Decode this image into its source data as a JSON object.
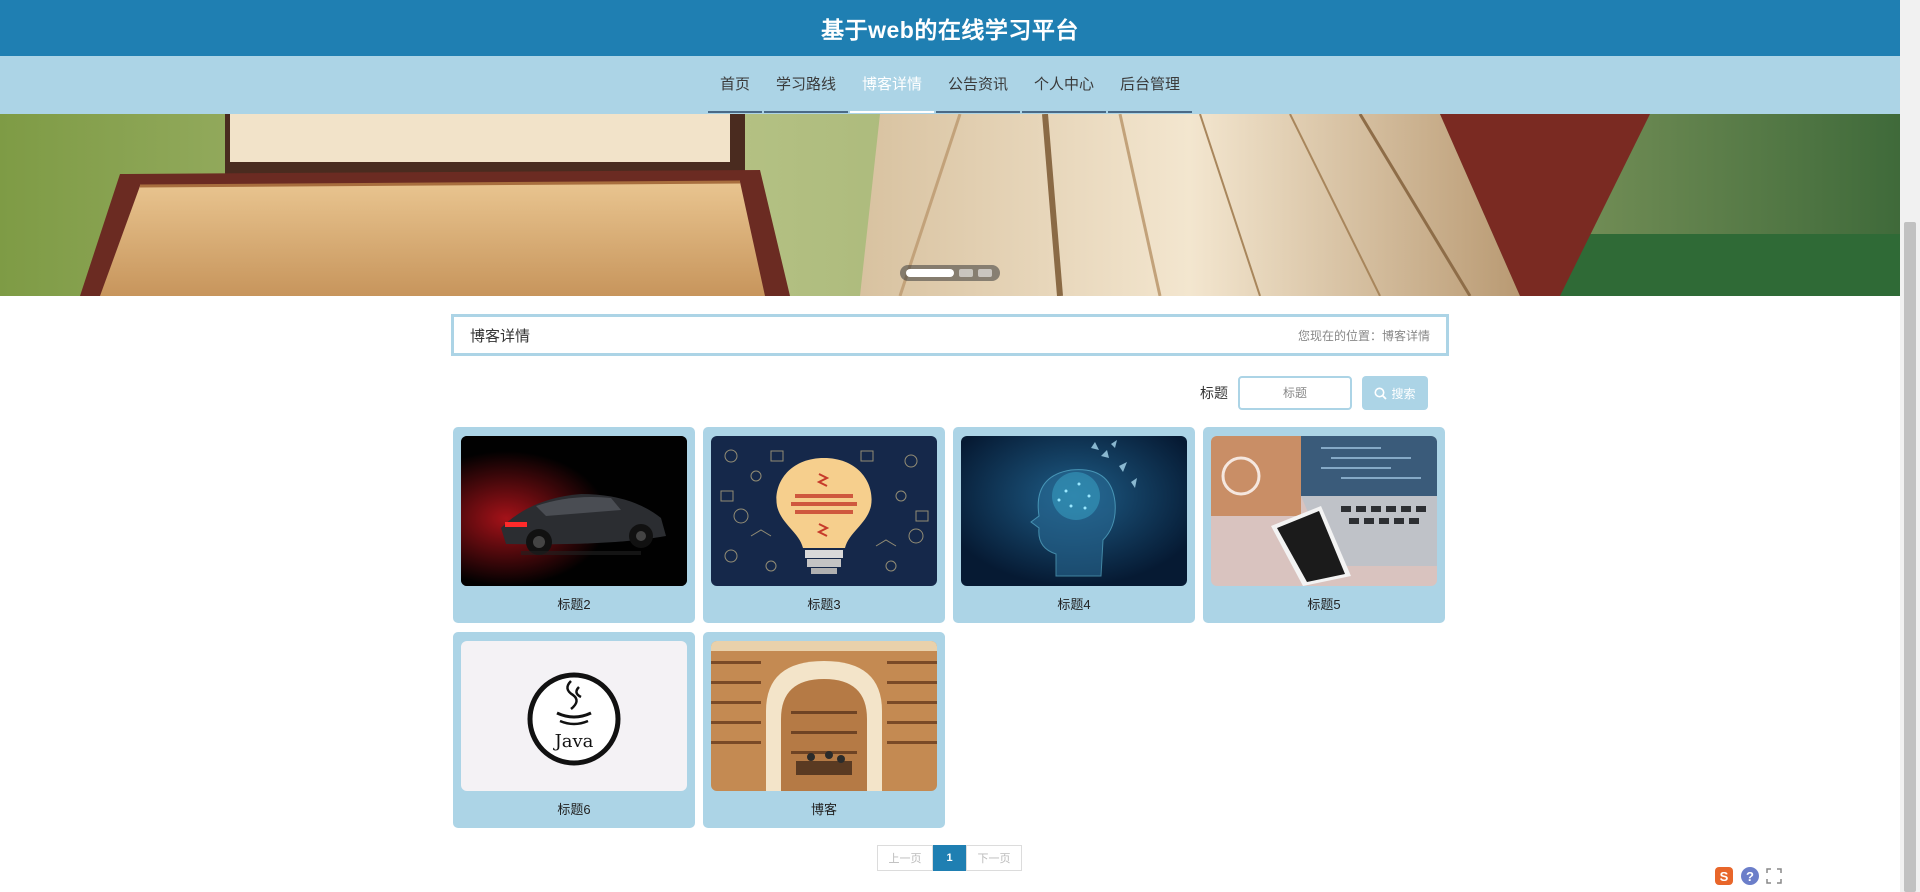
{
  "header": {
    "title": "基于web的在线学习平台"
  },
  "nav": {
    "items": [
      {
        "label": "首页",
        "active": false
      },
      {
        "label": "学习路线",
        "active": false
      },
      {
        "label": "博客详情",
        "active": true
      },
      {
        "label": "公告资讯",
        "active": false
      },
      {
        "label": "个人中心",
        "active": false
      },
      {
        "label": "后台管理",
        "active": false
      }
    ]
  },
  "banner": {
    "slide_count": 3,
    "active_slide": 1
  },
  "breadcrumb": {
    "title": "博客详情",
    "location": "您现在的位置：博客详情"
  },
  "search": {
    "label": "标题",
    "placeholder": "标题",
    "value": "",
    "button_label": "搜索"
  },
  "cards": [
    {
      "title": "标题2",
      "image": "sports-car"
    },
    {
      "title": "标题3",
      "image": "lightbulb-doodle"
    },
    {
      "title": "标题4",
      "image": "digital-brain-head"
    },
    {
      "title": "标题5",
      "image": "laptop-desk"
    },
    {
      "title": "标题6",
      "image": "java-logo"
    },
    {
      "title": "博客",
      "image": "bookstore-interior"
    }
  ],
  "pagination": {
    "prev_label": "上一页",
    "current_page": "1",
    "next_label": "下一页"
  },
  "colors": {
    "primary": "#1f7fb2",
    "accent_light": "#acd4e6"
  }
}
